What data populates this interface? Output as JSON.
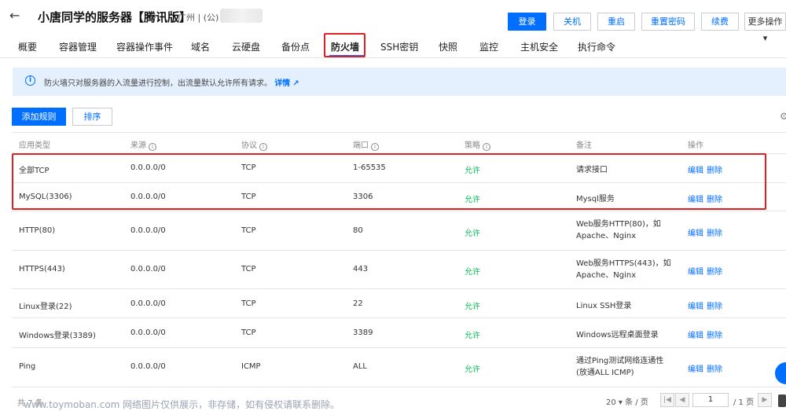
{
  "header": {
    "back_icon": "arrow-left-icon",
    "title": "小唐同学的服务器【腾讯版】",
    "region": "广州 | (公) 1.12",
    "buttons": {
      "login": "登录",
      "shutdown": "关机",
      "restart": "重启",
      "reset_password": "重置密码",
      "renew": "续费",
      "more": "更多操作 ▾"
    }
  },
  "tabs": [
    {
      "label": "概要"
    },
    {
      "label": "容器管理"
    },
    {
      "label": "容器操作事件"
    },
    {
      "label": "域名"
    },
    {
      "label": "云硬盘"
    },
    {
      "label": "备份点"
    },
    {
      "label": "防火墙",
      "active": true
    },
    {
      "label": "SSH密钥"
    },
    {
      "label": "快照"
    },
    {
      "label": "监控"
    },
    {
      "label": "主机安全"
    },
    {
      "label": "执行命令"
    }
  ],
  "notice": {
    "icon": "info-icon",
    "text": "防火墙只对服务器的入流量进行控制，出流量默认允许所有请求。",
    "link": "详情",
    "link_icon": "external-link-icon"
  },
  "toolbar": {
    "add_rule": "添加规则",
    "sort": "排序",
    "settings_icon": "gear-icon"
  },
  "table": {
    "columns": [
      "应用类型",
      "来源",
      "协议",
      "端口",
      "策略",
      "备注",
      "操作"
    ],
    "rows": [
      {
        "app": "全部TCP",
        "source": "0.0.0.0/0",
        "protocol": "TCP",
        "port": "1-65535",
        "policy": "允许",
        "remark": "请求接口",
        "edit": "编辑",
        "delete": "删除"
      },
      {
        "app": "MySQL(3306)",
        "source": "0.0.0.0/0",
        "protocol": "TCP",
        "port": "3306",
        "policy": "允许",
        "remark": "Mysql服务",
        "edit": "编辑",
        "delete": "删除"
      },
      {
        "app": "HTTP(80)",
        "source": "0.0.0.0/0",
        "protocol": "TCP",
        "port": "80",
        "policy": "允许",
        "remark": "Web服务HTTP(80)，如Apache、Nginx",
        "edit": "编辑",
        "delete": "删除"
      },
      {
        "app": "HTTPS(443)",
        "source": "0.0.0.0/0",
        "protocol": "TCP",
        "port": "443",
        "policy": "允许",
        "remark": "Web服务HTTPS(443)，如Apache、Nginx",
        "edit": "编辑",
        "delete": "删除"
      },
      {
        "app": "Linux登录(22)",
        "source": "0.0.0.0/0",
        "protocol": "TCP",
        "port": "22",
        "policy": "允许",
        "remark": "Linux SSH登录",
        "edit": "编辑",
        "delete": "删除"
      },
      {
        "app": "Windows登录(3389)",
        "source": "0.0.0.0/0",
        "protocol": "TCP",
        "port": "3389",
        "policy": "允许",
        "remark": "Windows远程桌面登录",
        "edit": "编辑",
        "delete": "删除"
      },
      {
        "app": "Ping",
        "source": "0.0.0.0/0",
        "protocol": "ICMP",
        "port": "ALL",
        "policy": "允许",
        "remark": "通过Ping测试网络连通性(放通ALL ICMP)",
        "edit": "编辑",
        "delete": "删除"
      }
    ]
  },
  "footer": {
    "total": "共 7 条",
    "page_size": "20 ▾ 条 / 页",
    "current_page": "1",
    "total_pages": "/ 1 页"
  },
  "watermark": "www.toymoban.com 网络图片仅供展示，非存储，如有侵权请联系删除。",
  "colors": {
    "accent": "#006eff",
    "allow": "#0abf5b",
    "highlight": "#e02020",
    "notice_bg": "#e5f0ff"
  }
}
